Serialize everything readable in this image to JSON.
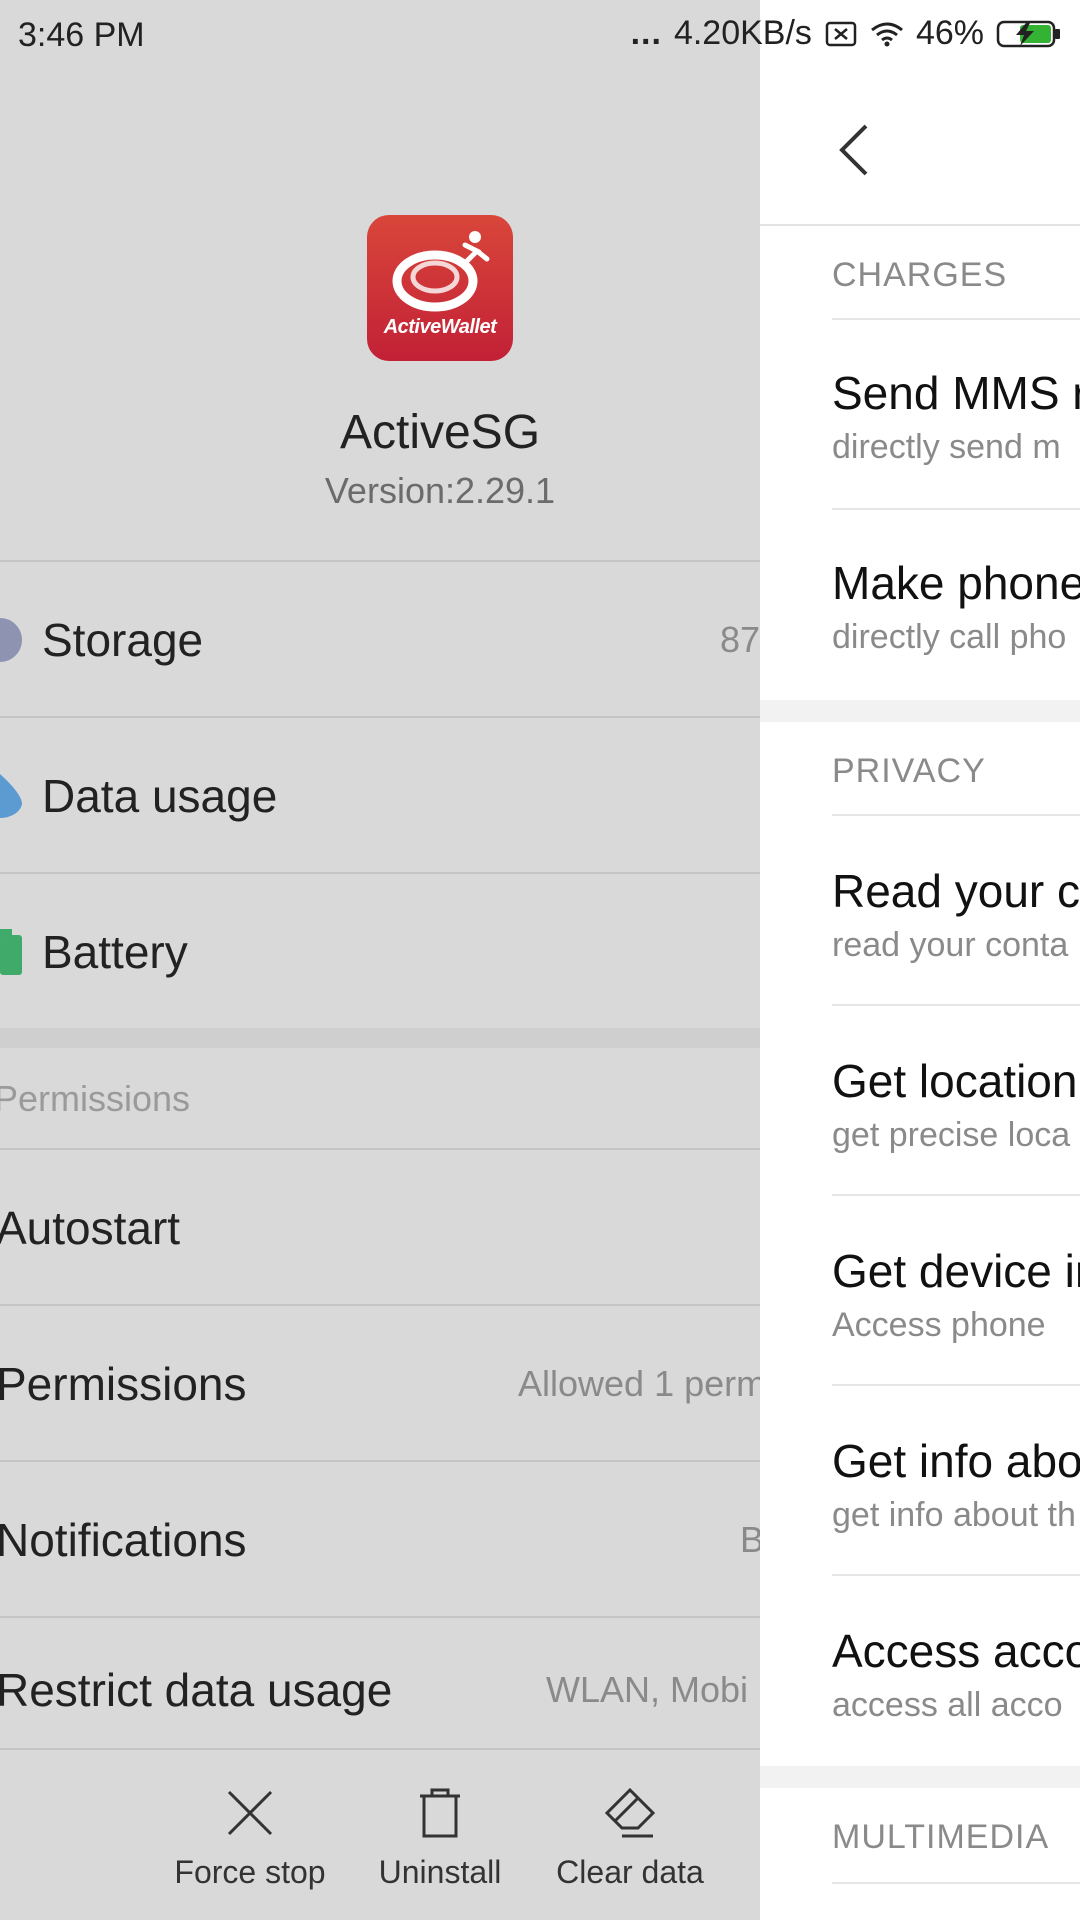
{
  "status_bar": {
    "time": "3:46 PM",
    "dots": "...",
    "speed": "4.20KB/s",
    "battery": "46%"
  },
  "app": {
    "icon_text": "ActiveWallet",
    "name": "ActiveSG",
    "version": "Version:2.29.1"
  },
  "rows": {
    "storage": {
      "label": "Storage",
      "value": "87"
    },
    "data_usage": {
      "label": "Data usage"
    },
    "battery": {
      "label": "Battery"
    },
    "permissions_header": "Permissions",
    "autostart": {
      "label": "Autostart"
    },
    "permissions": {
      "label": "Permissions",
      "value": "Allowed 1 perm"
    },
    "notifications": {
      "label": "Notifications",
      "value": "B"
    },
    "restrict": {
      "label": "Restrict data usage",
      "value": "WLAN, Mobi"
    }
  },
  "actions": {
    "force_stop": "Force stop",
    "uninstall": "Uninstall",
    "clear_data": "Clear data"
  },
  "panel": {
    "sections": {
      "charges": "CHARGES",
      "privacy": "PRIVACY",
      "multimedia": "MULTIMEDIA"
    },
    "items": [
      {
        "title": "Send MMS r",
        "sub": "directly send m"
      },
      {
        "title": "Make phone",
        "sub": "directly call pho"
      },
      {
        "title": "Read your c",
        "sub": "read your conta"
      },
      {
        "title": "Get location",
        "sub": "get precise loca"
      },
      {
        "title": "Get device in",
        "sub": "Access phone"
      },
      {
        "title": "Get info abo",
        "sub": "get info about th"
      },
      {
        "title": "Access acco",
        "sub": "access all acco"
      }
    ]
  },
  "colors": {
    "storage_icon": "#8d93b0",
    "data_icon": "#5b9bd1",
    "battery_icon": "#3faa6a",
    "app_icon_top": "#d9463a",
    "app_icon_bottom": "#c22136"
  }
}
